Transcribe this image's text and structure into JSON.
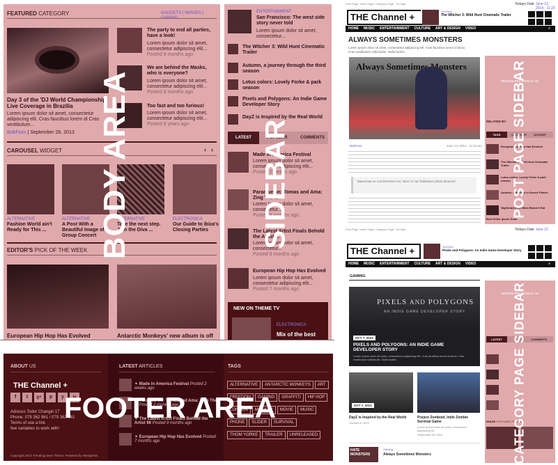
{
  "featured": {
    "heading_bold": "FEATURED",
    "heading_rest": "CATEGORY",
    "tabs": [
      "GADGETS",
      "MOVIES",
      "GAMING"
    ],
    "main_title": "Day 3 of the 'DJ World Championship' Live Coverage in Brazilia",
    "main_excerpt": "Lorem ipsum dolor sit amet, consectetur adipiscing elit. Cras faucibus lorem id Cras vestibulum...",
    "main_author": "BobFoxx",
    "main_date": "September 28, 2013",
    "side": [
      {
        "title": "The party to end all parties, have a look!",
        "ex": "Lorem ipsum dolor sit amet, consectetur adipiscing elit...",
        "time": "Posted 9 months ago"
      },
      {
        "title": "We are behind the Masks, who is everyone?",
        "ex": "Lorem ipsum dolor sit amet, consectetur adipiscing elit...",
        "time": "Posted 8 months ago"
      },
      {
        "title": "Too fast and too furious!",
        "ex": "Lorem ipsum dolor sit amet, consectetur adipiscing elit...",
        "time": "Posted 6 years ago"
      }
    ]
  },
  "carousel": {
    "heading_bold": "CAROUSEL",
    "heading_rest": "WIDGET",
    "items": [
      {
        "cat": "ALTERNATIVE",
        "title": "Fashion World ain't Ready for This ..."
      },
      {
        "cat": "ALTERNATIVE",
        "title": "A Post With a Beautiful Image of a Group Concert"
      },
      {
        "cat": "ALTERNATIVE",
        "title": "Take the next step. Join the Diva ..."
      },
      {
        "cat": "ELECTRONICA",
        "title": "Our Guide to Ibiza's Closing Parties"
      }
    ]
  },
  "editors": {
    "heading_bold": "EDITOR'S",
    "heading_rest": "PICK OF THE WEEK",
    "items": [
      {
        "title": "European Hip Hop Has Evolved"
      },
      {
        "title": "Antarctic Monkeys' new album is off"
      }
    ]
  },
  "sidebar": {
    "top": {
      "cat": "ENTERTAINMENT",
      "title": "San Francisco: The west side story never told",
      "ex": "Lorem ipsum dolor sit amet, consectetur..."
    },
    "list": [
      "The Witcher 3: Wild Hunt Cinematic Trailer",
      "Autumn, a journey through the third season",
      "Lotus colors: Lovely Forke & park season",
      "Pixels and Polygons: An Indie Game Developer Story",
      "DayZ is Inspired by the Real World"
    ],
    "tabs": [
      "LATEST",
      "POPULAR",
      "COMMENTS"
    ],
    "posts": [
      {
        "title": "Made in America Festival",
        "ex": "Lorem ipsum dolor sit amet, consectetur adipiscing elit...",
        "time": "Posted 2 weeks ago"
      },
      {
        "title": "Paradise on: Tomas and Ama: Zing The ...",
        "ex": "Lorem ipsum dolor sit amet, consectetur...",
        "time": "Posted 9 months ago"
      },
      {
        "title": "The Latest Artist Finals Behold the Artist ...",
        "ex": "Lorem ipsum dolor sit amet, consectetur...",
        "time": "Posted 9 months ago"
      },
      {
        "title": "European Hip Hop Has Evolved",
        "ex": "Lorem ipsum dolor sit amet, consectetur adipiscing elit...",
        "time": "Posted 7 months ago"
      }
    ],
    "tv_heading": "NEW ON THEME TV",
    "tv_cat": "ELECTRONICA",
    "tv_title": "Mix of the best"
  },
  "footer": {
    "about_bold": "ABOUT",
    "about_rest": "US",
    "logo": "THE Channel +",
    "social": [
      "f",
      "t",
      "g+",
      "p",
      "y",
      "in"
    ],
    "address": "Adresss Todor Changin 17",
    "phone": "Phone: 079 362 961 / 079 362 961",
    "terms": "Terms of use a link",
    "few": "few variables to work with!",
    "copyright": "Copyright 2013 Trending news Theme. Powered by Wordpress.",
    "latest_bold": "LATEST",
    "latest_rest": "ARTICLES",
    "latest": [
      {
        "title": "Made in America Festival",
        "time": "Posted 2 weeks ago"
      },
      {
        "title": "Paradise on: Tomas and Ama: Zing The ...",
        "time": "Posted 2 months ago"
      },
      {
        "title": "The Latest Artist Finals Behold the Artist 96",
        "time": "Posted 9 months ago"
      },
      {
        "title": "European Hip Hop Has Evolved",
        "time": "Posted 7 months ago"
      }
    ],
    "tags_heading": "TAGS",
    "tags": [
      "ALTERNATIVE",
      "ANTARCTIC MONKEYS",
      "ART",
      "FREEDOM",
      "GAMING",
      "GRAFFITI",
      "HIP HOP",
      "LONDON",
      "MONKEY",
      "MOVIE",
      "MUSIC",
      "PHONE",
      "SLIDER",
      "SURVIVAL",
      "THOM YORKE",
      "TRAILER",
      "UNRELEASED"
    ]
  },
  "overlay": {
    "body": "BODY AREA",
    "sidebar": "SIDEBAR",
    "footer": "FOOTER AREA",
    "post_sidebar": "POST PAGE SIDEBAR",
    "cat_sidebar": "CATEGORY PAGE SIDEBAR"
  },
  "post_page": {
    "topnav": [
      "First Page",
      "Index Page",
      "Category Page",
      "To Page"
    ],
    "today": "Todays Date",
    "date": "June 12, 2014 - 11:23 am",
    "logo": "THE Channel +",
    "promo_cat": "YouTube",
    "promo_title": "The Witcher 3: Wild Hunt Cinematic Trailer",
    "nav": [
      "HOME",
      "MUSIC",
      "ENTERTAINMENT",
      "CULTURE",
      "ART & DESIGN",
      "VIDEO"
    ],
    "title": "ALWAYS SOMETIMES MONSTERS",
    "ex1": "Lorem ipsum dolor sit amet, consectetur adipiscing elit. Cras faucibus lorem id lacus",
    "ex2": "Cras vestibulum sollicitudin. Nulla facilisi.",
    "poster": "Always Sometimes Monsters",
    "author": "BobFoxx",
    "quote": "Maecenas ac condimentum leo. Nunc in hac habitasse platea dictumst.",
    "ad": "MEDIUM RECTANGLE AD",
    "related": "RELATED BY",
    "rel_tabs": [
      "TAGS",
      "CATEGORY",
      "AUTHOR"
    ],
    "side": [
      "European Hip Hop Has Evolved",
      "The Witcher 3: Wild Hunt Cinematic Trailer",
      "Lotus colors: Lovely Forke & park season",
      "Autumn, a journey in Scenic Places",
      "Nightmares the Mars Brand 8 Hat"
    ],
    "best": "Best Seller",
    "best_by": "Ipsum Suits"
  },
  "cat_page": {
    "topnav": [
      "First Page",
      "Index Page",
      "Category Page",
      "To Page"
    ],
    "today": "Todays Date",
    "date": "June 12",
    "logo": "THE Channel +",
    "promo_cat": "YouTube",
    "promo_title": "Pixels and Polygons: An Indie Game Developer Story",
    "nav": [
      "HOME",
      "MUSIC",
      "ENTERTAINMENT",
      "CULTURE",
      "ART & DESIGN",
      "VIDEO"
    ],
    "section": "GAMING",
    "hero_t1": "PIXELS",
    "hero_and": "AND",
    "hero_t2": "POLYGONS",
    "hero_sub": "AN INDIE GAME DEVELOPER STORY",
    "hero_date": "OCT 7, 2013",
    "hero_title": "PIXELS AND POLYGONS: AN INDIE GAME DEVELOPER STORY",
    "hero_ex": "Lorem ipsum dolor sit amet, consectetur adipiscing elit. Cras faucibus lorem id lacus. Cras vestibulum sollicitudin. Nulla facilisi.",
    "g1_date": "OCT 7, 2013",
    "g1_title": "DayZ is Inspired by the Real World",
    "g1_date2": "October 8, 2013",
    "g2_title": "Project Zomboid, Indie Zombie Survival Game",
    "g2_ex": "Lorem ipsum dolor sit amet, consectetur adipiscing elit.",
    "g2_date": "September 28, 2013",
    "g3_cat": "Gaming",
    "g3_title": "Always Sometimes Monsters",
    "g3_thumb": "HATE MONSTERS",
    "ad": "MEDIUM RECTANGLE AD",
    "tabs": [
      "LATEST",
      "COMMENTS"
    ],
    "image": "IMAGE",
    "image_rest": "FEATURED POSTS"
  }
}
